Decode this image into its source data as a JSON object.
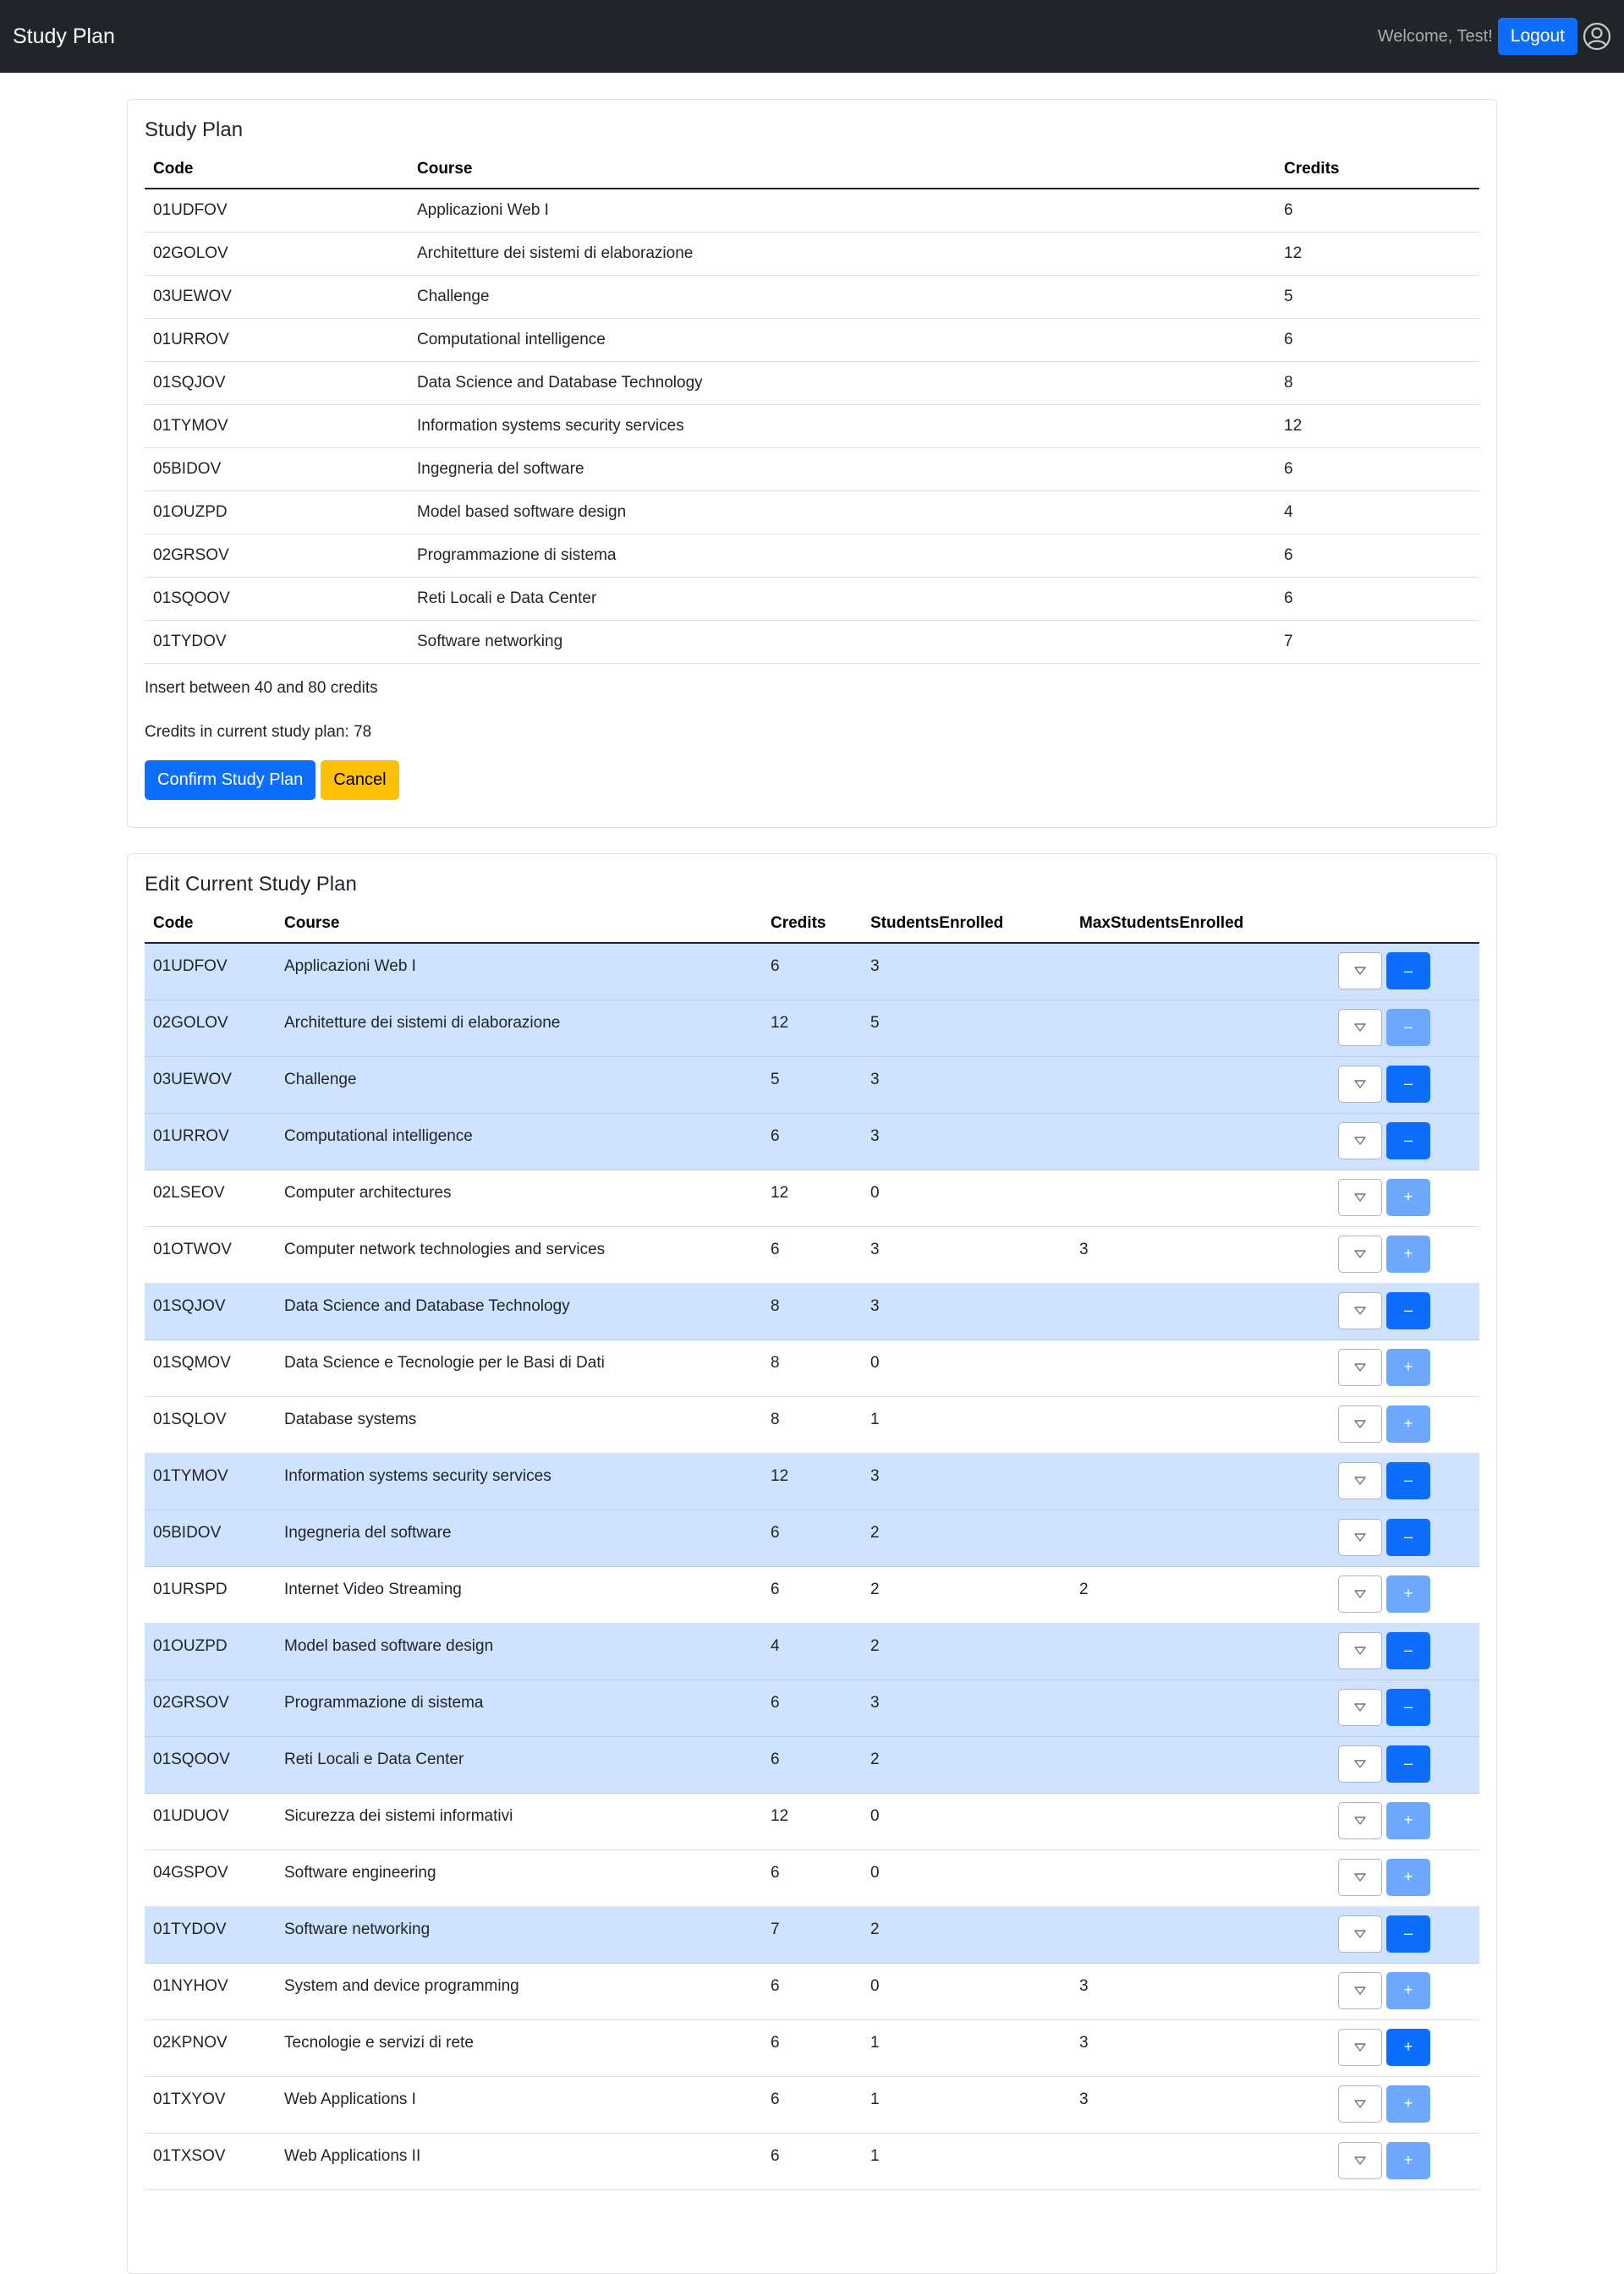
{
  "navbar": {
    "brand": "Study Plan",
    "welcome": "Welcome, Test!",
    "logout_label": "Logout",
    "user_icon": "person-circle-icon"
  },
  "study_plan": {
    "title": "Study Plan",
    "columns": [
      "Code",
      "Course",
      "Credits"
    ],
    "rows": [
      {
        "code": "01UDFOV",
        "course": "Applicazioni Web I",
        "credits": "6"
      },
      {
        "code": "02GOLOV",
        "course": "Architetture dei sistemi di elaborazione",
        "credits": "12"
      },
      {
        "code": "03UEWOV",
        "course": "Challenge",
        "credits": "5"
      },
      {
        "code": "01URROV",
        "course": "Computational intelligence",
        "credits": "6"
      },
      {
        "code": "01SQJOV",
        "course": "Data Science and Database Technology",
        "credits": "8"
      },
      {
        "code": "01TYMOV",
        "course": "Information systems security services",
        "credits": "12"
      },
      {
        "code": "05BIDOV",
        "course": "Ingegneria del software",
        "credits": "6"
      },
      {
        "code": "01OUZPD",
        "course": "Model based software design",
        "credits": "4"
      },
      {
        "code": "02GRSOV",
        "course": "Programmazione di sistema",
        "credits": "6"
      },
      {
        "code": "01SQOOV",
        "course": "Reti Locali e Data Center",
        "credits": "6"
      },
      {
        "code": "01TYDOV",
        "course": "Software networking",
        "credits": "7"
      }
    ],
    "range_text": "Insert between 40 and 80 credits",
    "current_credits_text": "Credits in current study plan: 78",
    "confirm_label": "Confirm Study Plan",
    "cancel_label": "Cancel"
  },
  "edit_plan": {
    "title": "Edit Current Study Plan",
    "columns": [
      "Code",
      "Course",
      "Credits",
      "StudentsEnrolled",
      "MaxStudentsEnrolled"
    ],
    "expand_icon": "triangle-down-icon",
    "remove_symbol": "–",
    "add_symbol": "+",
    "rows": [
      {
        "code": "01UDFOV",
        "course": "Applicazioni Web I",
        "credits": "6",
        "enrolled": "3",
        "max": "",
        "selected": true,
        "action": "remove",
        "disabled": false
      },
      {
        "code": "02GOLOV",
        "course": "Architetture dei sistemi di elaborazione",
        "credits": "12",
        "enrolled": "5",
        "max": "",
        "selected": true,
        "action": "remove",
        "disabled": true
      },
      {
        "code": "03UEWOV",
        "course": "Challenge",
        "credits": "5",
        "enrolled": "3",
        "max": "",
        "selected": true,
        "action": "remove",
        "disabled": false
      },
      {
        "code": "01URROV",
        "course": "Computational intelligence",
        "credits": "6",
        "enrolled": "3",
        "max": "",
        "selected": true,
        "action": "remove",
        "disabled": false
      },
      {
        "code": "02LSEOV",
        "course": "Computer architectures",
        "credits": "12",
        "enrolled": "0",
        "max": "",
        "selected": false,
        "action": "add",
        "disabled": true
      },
      {
        "code": "01OTWOV",
        "course": "Computer network technologies and services",
        "credits": "6",
        "enrolled": "3",
        "max": "3",
        "selected": false,
        "action": "add",
        "disabled": true
      },
      {
        "code": "01SQJOV",
        "course": "Data Science and Database Technology",
        "credits": "8",
        "enrolled": "3",
        "max": "",
        "selected": true,
        "action": "remove",
        "disabled": false
      },
      {
        "code": "01SQMOV",
        "course": "Data Science e Tecnologie per le Basi di Dati",
        "credits": "8",
        "enrolled": "0",
        "max": "",
        "selected": false,
        "action": "add",
        "disabled": true
      },
      {
        "code": "01SQLOV",
        "course": "Database systems",
        "credits": "8",
        "enrolled": "1",
        "max": "",
        "selected": false,
        "action": "add",
        "disabled": true
      },
      {
        "code": "01TYMOV",
        "course": "Information systems security services",
        "credits": "12",
        "enrolled": "3",
        "max": "",
        "selected": true,
        "action": "remove",
        "disabled": false
      },
      {
        "code": "05BIDOV",
        "course": "Ingegneria del software",
        "credits": "6",
        "enrolled": "2",
        "max": "",
        "selected": true,
        "action": "remove",
        "disabled": false
      },
      {
        "code": "01URSPD",
        "course": "Internet Video Streaming",
        "credits": "6",
        "enrolled": "2",
        "max": "2",
        "selected": false,
        "action": "add",
        "disabled": true
      },
      {
        "code": "01OUZPD",
        "course": "Model based software design",
        "credits": "4",
        "enrolled": "2",
        "max": "",
        "selected": true,
        "action": "remove",
        "disabled": false
      },
      {
        "code": "02GRSOV",
        "course": "Programmazione di sistema",
        "credits": "6",
        "enrolled": "3",
        "max": "",
        "selected": true,
        "action": "remove",
        "disabled": false
      },
      {
        "code": "01SQOOV",
        "course": "Reti Locali e Data Center",
        "credits": "6",
        "enrolled": "2",
        "max": "",
        "selected": true,
        "action": "remove",
        "disabled": false
      },
      {
        "code": "01UDUOV",
        "course": "Sicurezza dei sistemi informativi",
        "credits": "12",
        "enrolled": "0",
        "max": "",
        "selected": false,
        "action": "add",
        "disabled": true
      },
      {
        "code": "04GSPOV",
        "course": "Software engineering",
        "credits": "6",
        "enrolled": "0",
        "max": "",
        "selected": false,
        "action": "add",
        "disabled": true
      },
      {
        "code": "01TYDOV",
        "course": "Software networking",
        "credits": "7",
        "enrolled": "2",
        "max": "",
        "selected": true,
        "action": "remove",
        "disabled": false
      },
      {
        "code": "01NYHOV",
        "course": "System and device programming",
        "credits": "6",
        "enrolled": "0",
        "max": "3",
        "selected": false,
        "action": "add",
        "disabled": true
      },
      {
        "code": "02KPNOV",
        "course": "Tecnologie e servizi di rete",
        "credits": "6",
        "enrolled": "1",
        "max": "3",
        "selected": false,
        "action": "add",
        "disabled": false
      },
      {
        "code": "01TXYOV",
        "course": "Web Applications I",
        "credits": "6",
        "enrolled": "1",
        "max": "3",
        "selected": false,
        "action": "add",
        "disabled": true
      },
      {
        "code": "01TXSOV",
        "course": "Web Applications II",
        "credits": "6",
        "enrolled": "1",
        "max": "",
        "selected": false,
        "action": "add",
        "disabled": true
      }
    ]
  }
}
